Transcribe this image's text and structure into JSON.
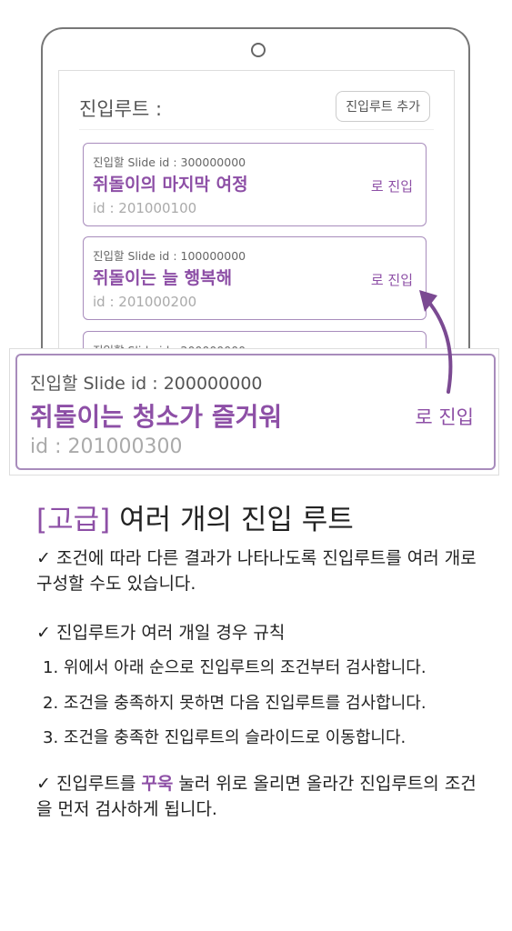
{
  "screen": {
    "title": "진입루트 :",
    "add_button": "진입루트 추가",
    "cards": [
      {
        "cond": "진입할 Slide id : 300000000",
        "name": "쥐돌이의 마지막 여정",
        "id": "id : 201000100",
        "go": "로 진입"
      },
      {
        "cond": "진입할 Slide id : 100000000",
        "name": "쥐돌이는 늘 행복해",
        "id": "id : 201000200",
        "go": "로 진입"
      },
      {
        "cond": "진입할 Slide id : 200000000"
      }
    ]
  },
  "zoom_card": {
    "cond": "진입할 Slide id : 200000000",
    "name": "쥐돌이는 청소가 즐거워",
    "id": "id : 201000300",
    "go": "로 진입"
  },
  "heading": {
    "tag": "[고급]",
    "title": "여러 개의 진입 루트"
  },
  "notes": {
    "p1": "✓ 조건에 따라 다른 결과가 나타나도록 진입루트를 여러 개로 구성할 수도 있습니다.",
    "p2": "✓ 진입루트가 여러 개일 경우 규칙",
    "rules": [
      "1. 위에서 아래 순으로 진입루트의 조건부터 검사합니다.",
      "2. 조건을 충족하지 못하면 다음 진입루트를 검사합니다.",
      "3. 조건을 충족한 진입루트의 슬라이드로 이동합니다."
    ],
    "p3_a": "✓ 진입루트를 ",
    "p3_hl": "꾸욱",
    "p3_b": " 눌러 위로 올리면 올라간 진입루트의 조건을 먼저 검사하게 됩니다."
  },
  "colors": {
    "accent": "#8d4fa6",
    "card_border": "#a88cbc"
  }
}
